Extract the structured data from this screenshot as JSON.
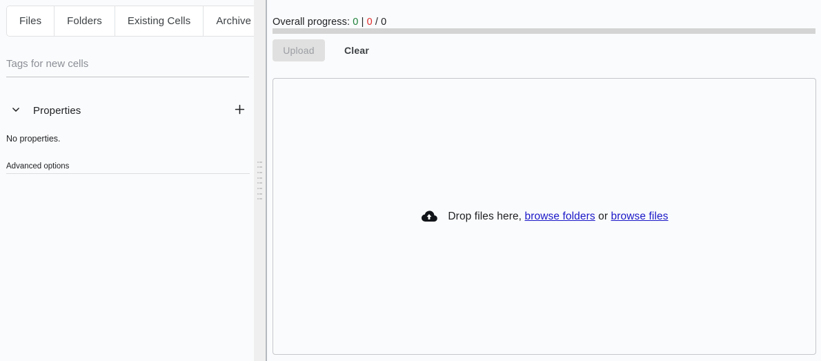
{
  "left_panel": {
    "tabs": [
      {
        "id": "files",
        "label": "Files"
      },
      {
        "id": "folders",
        "label": "Folders"
      },
      {
        "id": "existing-cells",
        "label": "Existing Cells"
      },
      {
        "id": "archive",
        "label": "Archive"
      }
    ],
    "tags_input": {
      "placeholder": "Tags for new cells",
      "value": ""
    },
    "properties": {
      "title": "Properties",
      "collapse_icon": "chevron-down-icon",
      "add_icon": "plus-icon",
      "empty_text": "No properties."
    },
    "advanced": {
      "label": "Advanced options"
    },
    "splitter": {
      "icon": "drag-handle-icon"
    }
  },
  "right_panel": {
    "progress": {
      "label": "Overall progress:",
      "succeeded": "0",
      "separator": "|",
      "failed": "0",
      "slash": "/",
      "total": "0",
      "percent": 0,
      "colors": {
        "succeeded": "#1a7f37",
        "failed": "#e02a2a",
        "track": "#d4d4d4"
      }
    },
    "actions": {
      "upload_label": "Upload",
      "upload_disabled": true,
      "clear_label": "Clear"
    },
    "dropzone": {
      "icon": "cloud-upload-icon",
      "text_before": "Drop files here,",
      "link_folders": "browse folders",
      "text_middle": "or",
      "link_files": "browse files"
    }
  }
}
